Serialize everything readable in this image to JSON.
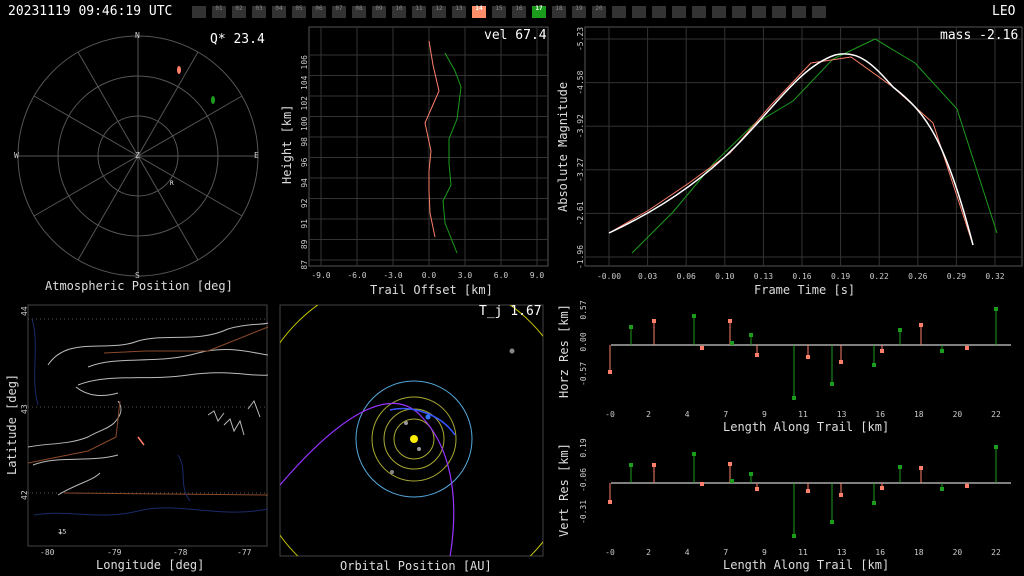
{
  "header": {
    "timestamp": "20231119 09:46:19 UTC",
    "right_label": "LEO",
    "cells": [
      "",
      "01",
      "02",
      "03",
      "04",
      "05",
      "06",
      "07",
      "08",
      "09",
      "10",
      "11",
      "12",
      "13",
      "14",
      "15",
      "16",
      "17",
      "18",
      "19",
      "20",
      "",
      "",
      "",
      "",
      "",
      "",
      "",
      "",
      "",
      "",
      ""
    ],
    "active_orange": "14",
    "active_green": "17",
    "colors": {
      "orange": "#ff8f6b",
      "green": "#1c9c1c",
      "cell": "#333333"
    }
  },
  "panels": {
    "atmospheric": {
      "title": "Atmospheric Position [deg]",
      "stat": "Q* 23.4",
      "compass": {
        "n": "N",
        "e": "E",
        "s": "S",
        "w": "W",
        "z": "Z",
        "r": "R"
      }
    },
    "trail": {
      "title": "Trail Offset [km]",
      "ylabel": "Height [km]",
      "stat": "vel 67.4",
      "xticks": [
        "-9.0",
        "-6.0",
        "-3.0",
        "0.0",
        "3.0",
        "6.0",
        "9.0"
      ],
      "yticks": [
        "87",
        "89",
        "91",
        "92",
        "94",
        "96",
        "98",
        "100",
        "102",
        "104",
        "106"
      ]
    },
    "magnitude": {
      "title": "Frame Time [s]",
      "ylabel": "Absolute Magnitude",
      "stat": "mass -2.16",
      "xticks": [
        "-0.00",
        "0.03",
        "0.06",
        "0.10",
        "0.13",
        "0.16",
        "0.19",
        "0.22",
        "0.26",
        "0.29",
        "0.32"
      ],
      "yticks": [
        "-5.23",
        "-4.58",
        "-3.92",
        "-3.27",
        "-2.61",
        "-1.96"
      ]
    },
    "map": {
      "xlabel": "Longitude [deg]",
      "ylabel": "Latitude [deg]",
      "xticks": [
        "-80",
        "-79",
        "-78",
        "-77"
      ],
      "yticks": [
        "44",
        "43",
        "42"
      ],
      "marker": "15"
    },
    "orbital": {
      "title": "Orbital Position [AU]",
      "stat": "T_j 1.67"
    },
    "horz": {
      "title": "Length Along Trail [km]",
      "ylabel": "Horz Res [km]",
      "yticks": [
        "0.57",
        "0.00",
        "-0.57"
      ],
      "xticks": [
        "-0",
        "2",
        "4",
        "7",
        "9",
        "11",
        "13",
        "16",
        "18",
        "20",
        "22"
      ]
    },
    "vert": {
      "title": "Length Along Trail [km]",
      "ylabel": "Vert Res [km]",
      "yticks": [
        "0.19",
        "-0.06",
        "-0.31"
      ],
      "xticks": [
        "-0",
        "2",
        "4",
        "7",
        "9",
        "11",
        "13",
        "16",
        "18",
        "20",
        "22"
      ]
    }
  }
}
